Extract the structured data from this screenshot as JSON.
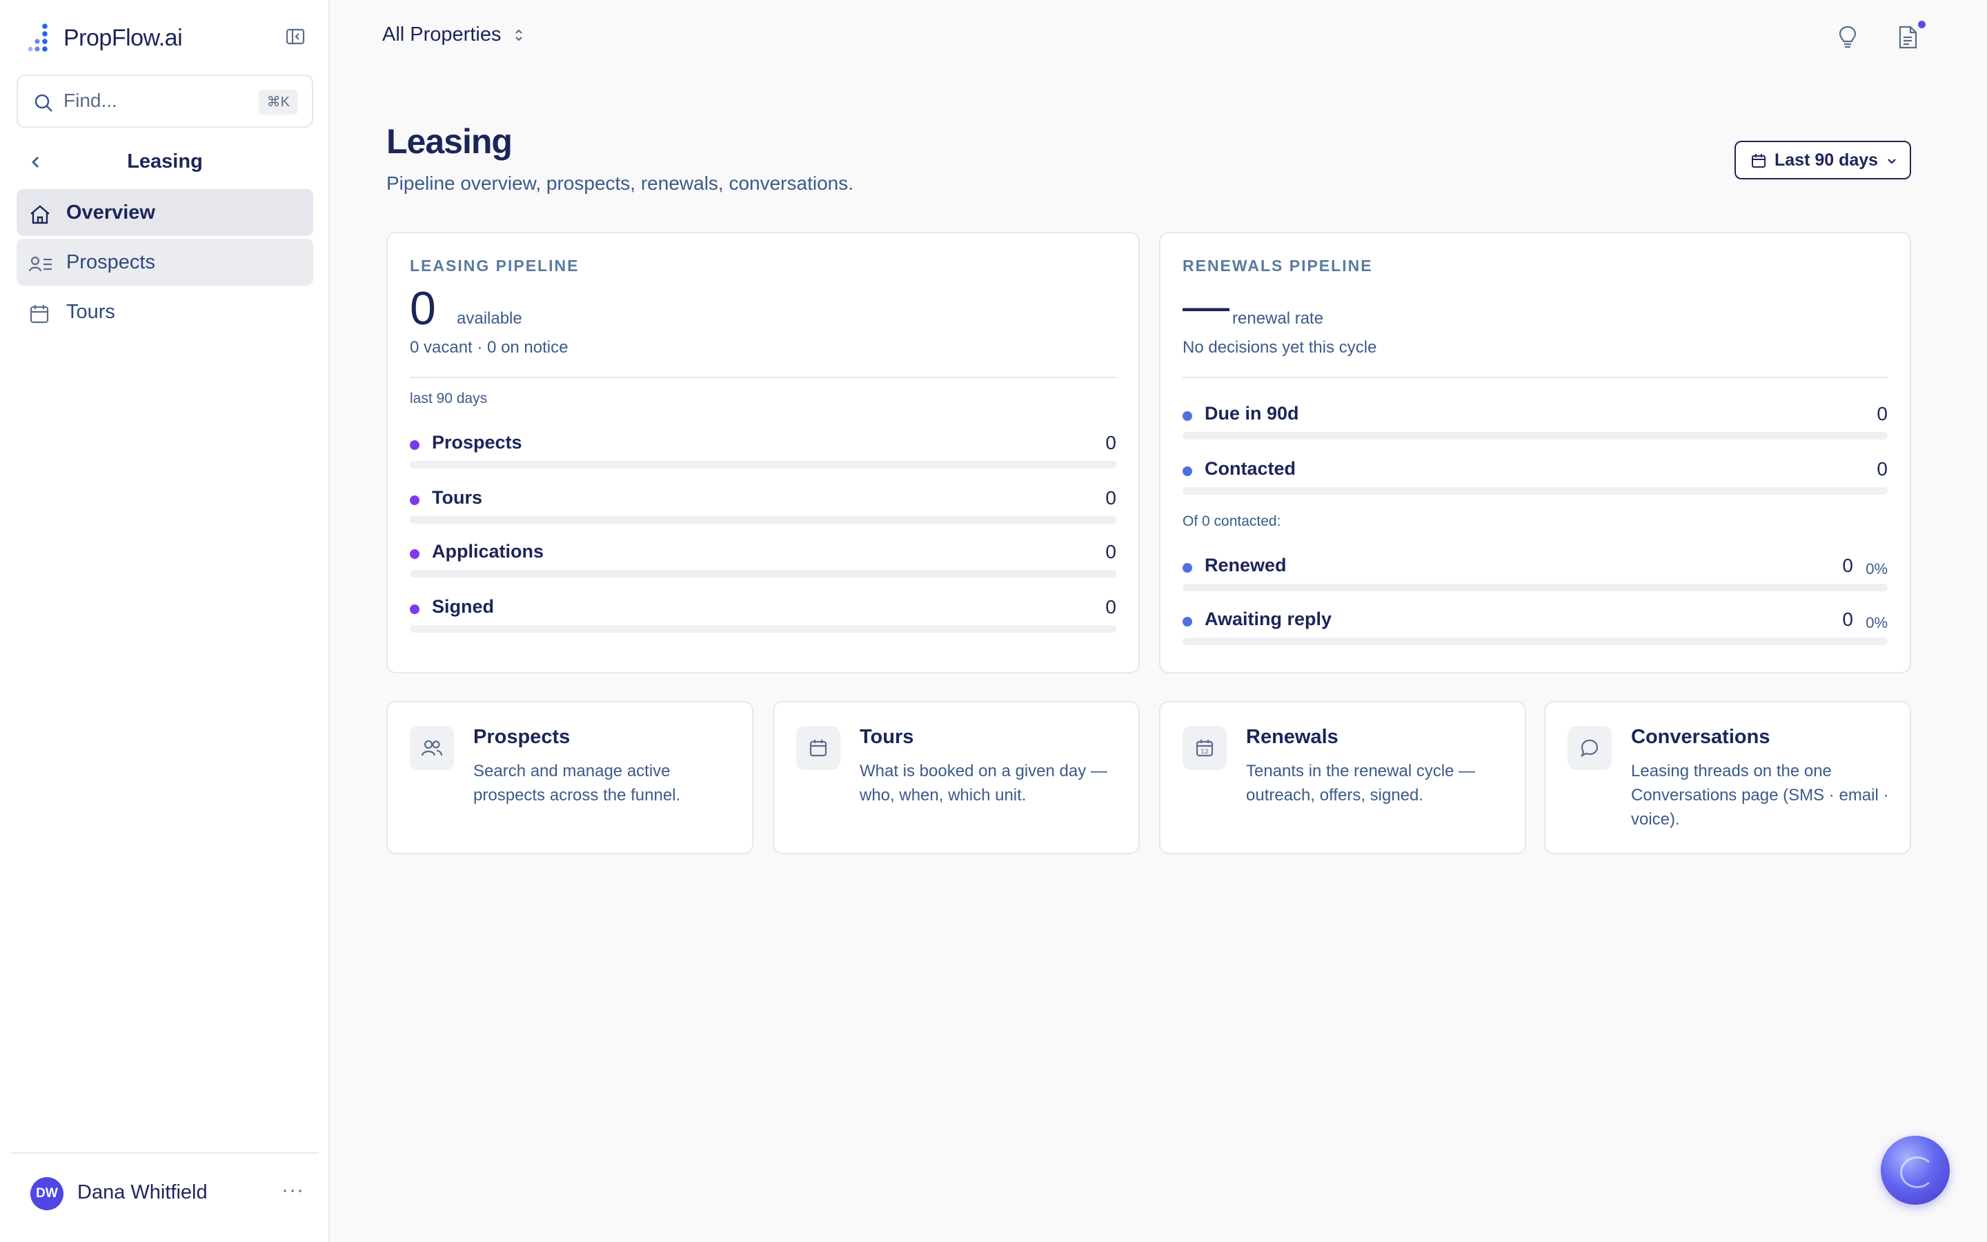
{
  "brand": {
    "name": "PropFlow.ai"
  },
  "search": {
    "placeholder": "Find...",
    "shortcut": "⌘K"
  },
  "sidebar": {
    "section_title": "Leasing",
    "items": [
      {
        "label": "Overview",
        "icon": "home-icon",
        "active": true
      },
      {
        "label": "Prospects",
        "icon": "prospects-icon",
        "active": false
      },
      {
        "label": "Tours",
        "icon": "calendar-icon",
        "active": false
      }
    ],
    "user": {
      "initials": "DW",
      "name": "Dana Whitfield",
      "more": "···"
    }
  },
  "topbar": {
    "property_selector": "All Properties",
    "has_notification": true
  },
  "header": {
    "title": "Leasing",
    "subtitle": "Pipeline overview, prospects, renewals, conversations.",
    "date_range": "Last 90 days"
  },
  "leasing_pipeline": {
    "label": "LEASING PIPELINE",
    "value": "0",
    "value_unit": "available",
    "detail": "0 vacant · 0 on notice",
    "period_note": "last 90 days",
    "color": "#7c3aed",
    "metrics": [
      {
        "label": "Prospects",
        "value": "0",
        "fraction": 0
      },
      {
        "label": "Tours",
        "value": "0",
        "fraction": 0
      },
      {
        "label": "Applications",
        "value": "0",
        "fraction": 0
      },
      {
        "label": "Signed",
        "value": "0",
        "fraction": 0
      }
    ]
  },
  "renewals_pipeline": {
    "label": "RENEWALS PIPELINE",
    "value": "—",
    "value_unit": "renewal rate",
    "detail": "No decisions yet this cycle",
    "contacted_note": "Of 0 contacted:",
    "color": "#4f6fe0",
    "metrics": [
      {
        "label": "Due in 90d",
        "value": "0",
        "fraction": 0
      },
      {
        "label": "Contacted",
        "value": "0",
        "fraction": 0
      }
    ],
    "outcomes": [
      {
        "label": "Renewed",
        "value": "0",
        "percent": "0%",
        "fraction": 0
      },
      {
        "label": "Awaiting reply",
        "value": "0",
        "percent": "0%",
        "fraction": 0
      }
    ]
  },
  "links": [
    {
      "title": "Prospects",
      "description": "Search and manage active prospects across the funnel.",
      "icon": "people-icon"
    },
    {
      "title": "Tours",
      "description": "What is booked on a given day — who, when, which unit.",
      "icon": "calendar-icon"
    },
    {
      "title": "Renewals",
      "description": "Tenants in the renewal cycle — outreach, offers, signed.",
      "icon": "calendar-date-icon",
      "icon_text": "12"
    },
    {
      "title": "Conversations",
      "description": "Leasing threads on the one Conversations page (SMS · email · voice).",
      "icon": "chat-bubble-icon"
    }
  ],
  "colors": {
    "brand": "#1b2559",
    "accent": "#5b4de6",
    "leasing_dot": "#7c3aed",
    "renewal_dot": "#4f6fe0"
  }
}
